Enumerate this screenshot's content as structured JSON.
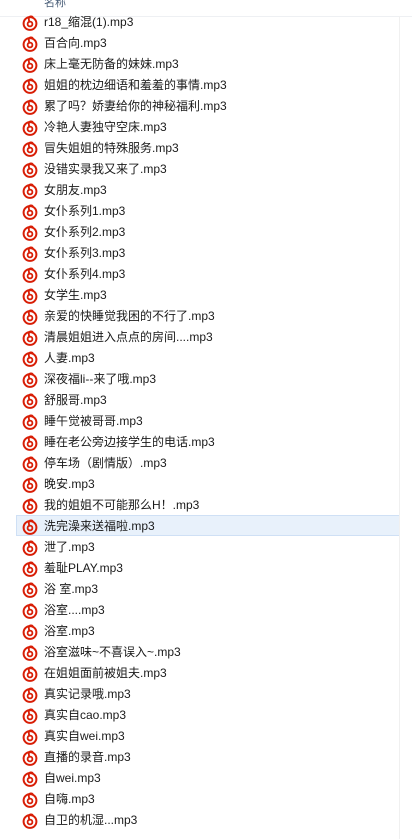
{
  "header": {
    "column_label": "名称"
  },
  "files": [
    "r18_缩混(1).mp3",
    "百合向.mp3",
    "床上毫无防备的妹妹.mp3",
    "姐姐的枕边细语和羞羞的事情.mp3",
    "累了吗？娇妻给你的神秘福利.mp3",
    "冷艳人妻独守空床.mp3",
    "冒失姐姐的特殊服务.mp3",
    "没错实录我又来了.mp3",
    "女朋友.mp3",
    "女仆系列1.mp3",
    "女仆系列2.mp3",
    "女仆系列3.mp3",
    "女仆系列4.mp3",
    "女学生.mp3",
    "亲爱的快睡觉我困的不行了.mp3",
    "清晨姐姐进入点点的房间....mp3",
    "人妻.mp3",
    "深夜福li--来了哦.mp3",
    "舒服哥.mp3",
    "睡午觉被哥哥.mp3",
    "睡在老公旁边接学生的电话.mp3",
    "停车场（剧情版）.mp3",
    "晚安.mp3",
    "我的姐姐不可能那么H！.mp3",
    "洗完澡来送福啦.mp3",
    "泄了.mp3",
    "羞耻PLAY.mp3",
    "浴 室.mp3",
    "浴室....mp3",
    "浴室.mp3",
    "浴室滋味~不喜误入~.mp3",
    "在姐姐面前被姐夫.mp3",
    "真实记录哦.mp3",
    "真实自cao.mp3",
    "真实自wei.mp3",
    "直播的录音.mp3",
    "自wei.mp3",
    "自嗨.mp3",
    "自卫的机湿...mp3"
  ],
  "hovered_index": 24,
  "colors": {
    "icon_red": "#d81e06",
    "hover_bg": "#e8f1fb",
    "hover_border": "#cfe0f5"
  },
  "icon_name": "netease-music-icon"
}
